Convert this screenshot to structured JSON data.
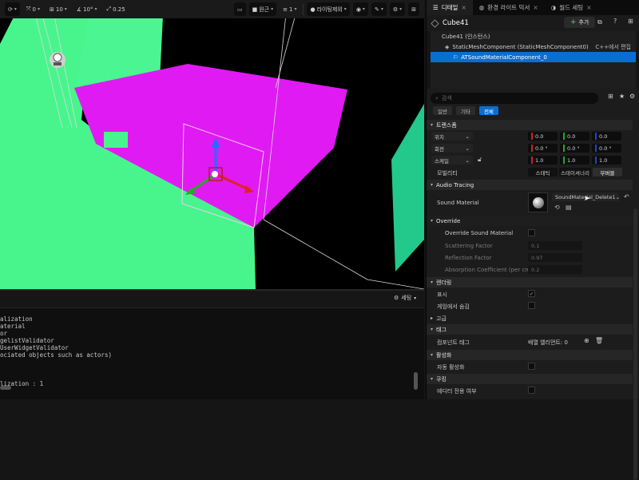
{
  "toolbar": {
    "snap_translate": "0",
    "grid_size": "10",
    "rotation_snap": "10°",
    "scale_snap": "0.25",
    "perspective_label": "원근",
    "lighting_label": "라이팅제외",
    "unknown_count": "1"
  },
  "output": {
    "settings_label": "세팅",
    "lines": [
      "alization",
      "aterial",
      "or",
      "gelistValidator",
      "UserWidgetValidator",
      "ociated objects such as actors)",
      "",
      "",
      "",
      "lization : 1"
    ]
  },
  "tabs": [
    {
      "label": "디테일",
      "icon": "details-icon"
    },
    {
      "label": "환경 라이트 믹서",
      "icon": "globe-icon"
    },
    {
      "label": "월드 세팅",
      "icon": "world-settings-icon"
    }
  ],
  "actor": {
    "name": "Cube41",
    "add_label": "추가"
  },
  "components": [
    {
      "label": "Cube41 (인스턴스)"
    },
    {
      "label": "StaticMeshComponent (StaticMeshComponent0)",
      "extra": "C++에서 편집"
    },
    {
      "label": "ATSoundMaterialComponent_0"
    }
  ],
  "details": {
    "search_placeholder": "검색",
    "filters": [
      "일반",
      "기타",
      "전체"
    ],
    "transform": {
      "category": "트랜스폼",
      "location_label": "위치",
      "rotation_label": "회전",
      "scale_label": "스케일",
      "location": [
        "0.0",
        "0.0",
        "0.0"
      ],
      "rotation": [
        "0.0 °",
        "0.0 °",
        "0.0 °"
      ],
      "scale": [
        "1.0",
        "1.0",
        "1.0"
      ],
      "mobility_label": "모빌리티",
      "mobility": [
        "스태틱",
        "스테이셔너리",
        "무버블"
      ],
      "mobility_selected": "무버블"
    },
    "audio_tracing": {
      "category": "Audio Tracing",
      "sound_material_label": "Sound Material",
      "sound_material_value": "SoundMaterial_Delete1"
    },
    "override": {
      "category": "Override",
      "override_label": "Override Sound Material",
      "scattering_label": "Scattering Factor",
      "scattering_value": "0.1",
      "reflection_label": "Reflection Factor",
      "reflection_value": "0.97",
      "absorption_label": "Absorption Coefficient (per cm)",
      "absorption_value": "0.2"
    },
    "rendering": {
      "category": "렌더링",
      "visible_label": "표시",
      "visible": true,
      "hidden_in_game_label": "게임에서 숨김",
      "hidden_in_game": false
    },
    "advanced": {
      "category": "고급"
    },
    "tags": {
      "category": "태그",
      "component_tags_label": "컴포넌트 태그",
      "array_label": "배열 엘리먼트: 0"
    },
    "activation": {
      "category": "활성화",
      "auto_activate_label": "자동 활성화"
    },
    "cooking": {
      "category": "쿠킹",
      "editor_only_label": "에디터 전용 여부"
    }
  }
}
